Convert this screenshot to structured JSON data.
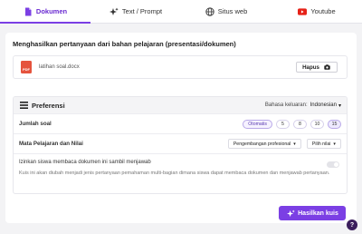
{
  "tabs": [
    {
      "label": "Dokumen",
      "icon": "document-icon",
      "active": true
    },
    {
      "label": "Text / Prompt",
      "icon": "sparkle-icon",
      "active": false
    },
    {
      "label": "Situs web",
      "icon": "globe-icon",
      "active": false
    },
    {
      "label": "Youtube",
      "icon": "youtube-icon",
      "active": false
    }
  ],
  "main": {
    "heading": "Menghasilkan pertanyaan dari bahan pelajaran (presentasi/dokumen)",
    "file": {
      "name": "latihan soal.docx",
      "badge": "PDF",
      "delete_label": "Hapus"
    },
    "preferences": {
      "title": "Preferensi",
      "language_label": "Bahasa keluaran:",
      "language_value": "Indonesian",
      "question_count": {
        "label": "Jumlah soal",
        "options": [
          "Otomatis",
          "5",
          "8",
          "10",
          "15"
        ]
      },
      "subject": {
        "label": "Mata Pelajaran dan Nilai",
        "subject_value": "Pengembangan profesional",
        "grade_value": "Pilih nilai"
      },
      "quiz_mode": {
        "title": "Izinkan siswa membaca dokumen ini sambil menjawab",
        "description": "Kuis ini akan diubah menjadi jenis pertanyaan pemahaman multi-bagian dimana siswa dapat membaca dokumen dan menjawab pertanyaan.",
        "enabled": false
      }
    },
    "generate_label": "Hasilkan kuis"
  },
  "help_label": "?",
  "colors": {
    "accent": "#7b3fe4",
    "pdf_red": "#e5533d",
    "youtube_red": "#e62117"
  }
}
